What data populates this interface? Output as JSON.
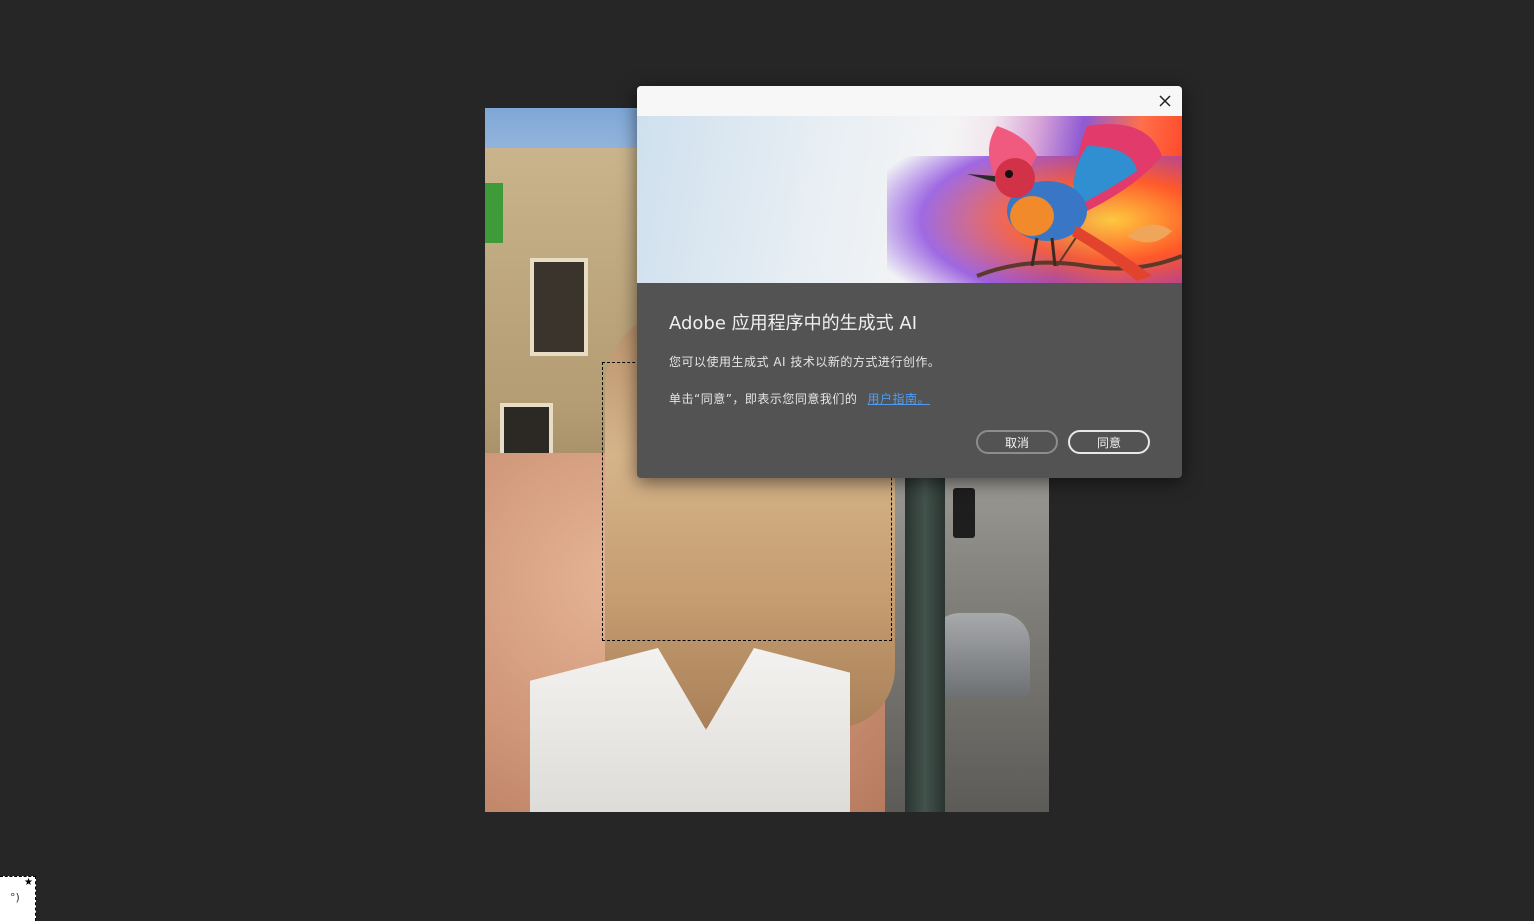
{
  "canvas": {
    "background": "#262626"
  },
  "dialog": {
    "title": "Adobe 应用程序中的生成式 AI",
    "description": "您可以使用生成式 AI 技术以新的方式进行创作。",
    "terms_prefix": "单击“同意”，即表示您同意我们的",
    "terms_link": "用户指南。",
    "cancel_label": "取消",
    "agree_label": "同意",
    "close_icon": "close-icon",
    "hero_image": "bird-illustration"
  },
  "colors": {
    "dialog_bg": "#535353",
    "link": "#4d9df5",
    "titlebar": "#f7f7f7"
  }
}
